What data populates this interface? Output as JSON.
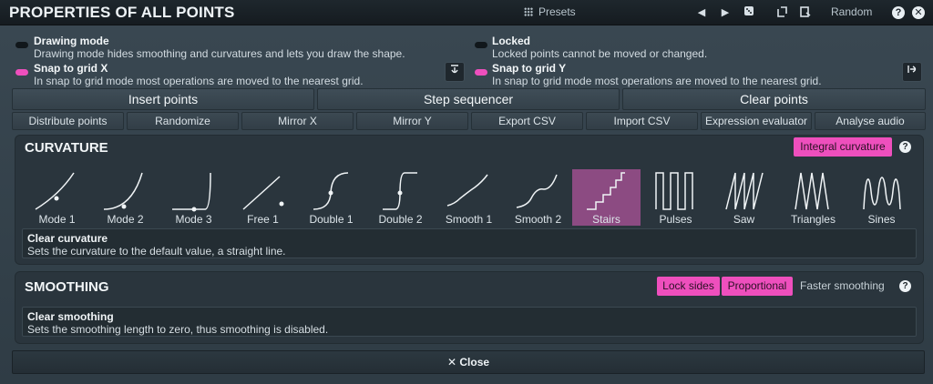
{
  "window": {
    "title": "PROPERTIES OF ALL POINTS"
  },
  "titlebar": {
    "presets_label": "Presets",
    "random_label": "Random"
  },
  "options": {
    "drawing_mode": {
      "title": "Drawing mode",
      "desc": "Drawing mode hides smoothing and curvatures and lets you draw the shape.",
      "on": false
    },
    "snap_x": {
      "title": "Snap to grid X",
      "desc": "In snap to grid mode most operations are moved to the nearest grid.",
      "on": true
    },
    "locked": {
      "title": "Locked",
      "desc": "Locked points cannot be moved or changed.",
      "on": false
    },
    "snap_y": {
      "title": "Snap to grid Y",
      "desc": "In snap to grid mode most operations are moved to the nearest grid.",
      "on": true
    }
  },
  "actions": {
    "insert_points": "Insert points",
    "step_sequencer": "Step sequencer",
    "clear_points": "Clear points"
  },
  "tools": [
    "Distribute points",
    "Randomize",
    "Mirror X",
    "Mirror Y",
    "Export CSV",
    "Import CSV",
    "Expression evaluator",
    "Analyse audio"
  ],
  "curvature": {
    "title": "CURVATURE",
    "integral_label": "Integral curvature",
    "modes": [
      "Mode 1",
      "Mode 2",
      "Mode 3",
      "Free 1",
      "Double 1",
      "Double 2",
      "Smooth 1",
      "Smooth 2",
      "Stairs",
      "Pulses",
      "Saw",
      "Triangles",
      "Sines"
    ],
    "selected": "Stairs",
    "info_title": "Clear curvature",
    "info_desc": "Sets the curvature to the default value, a straight line."
  },
  "smoothing": {
    "title": "SMOOTHING",
    "lock_sides": "Lock sides",
    "proportional": "Proportional",
    "faster": "Faster smoothing",
    "info_title": "Clear smoothing",
    "info_desc": "Sets the smoothing length to zero, thus smoothing is disabled."
  },
  "close_label": "Close",
  "colors": {
    "accent": "#ee4fbd",
    "selected_mode": "#8c4b82"
  }
}
